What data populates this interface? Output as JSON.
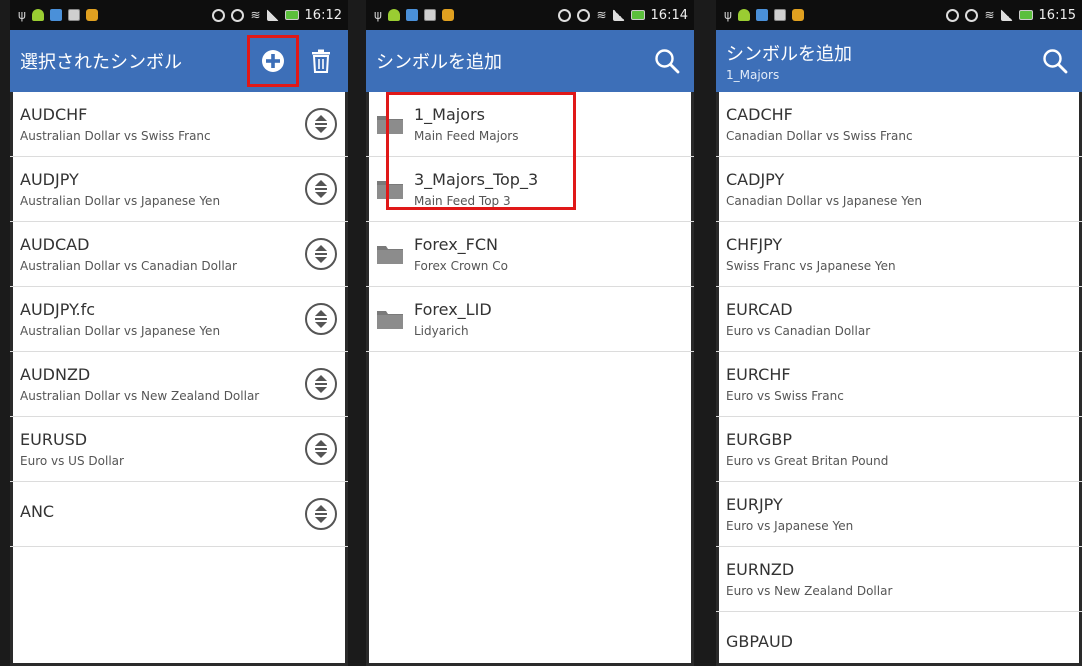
{
  "status_bars": [
    {
      "time": "16:12"
    },
    {
      "time": "16:14"
    },
    {
      "time": "16:15"
    }
  ],
  "screen1": {
    "title": "選択されたシンボル",
    "symbols": [
      {
        "name": "AUDCHF",
        "desc": "Australian Dollar vs Swiss Franc"
      },
      {
        "name": "AUDJPY",
        "desc": "Australian Dollar vs Japanese Yen"
      },
      {
        "name": "AUDCAD",
        "desc": "Australian Dollar vs Canadian Dollar"
      },
      {
        "name": "AUDJPY.fc",
        "desc": "Australian Dollar vs Japanese Yen"
      },
      {
        "name": "AUDNZD",
        "desc": "Australian Dollar vs New Zealand Dollar"
      },
      {
        "name": "EURUSD",
        "desc": "Euro vs US Dollar"
      },
      {
        "name": "ANC",
        "desc": ""
      }
    ]
  },
  "screen2": {
    "title": "シンボルを追加",
    "folders": [
      {
        "name": "1_Majors",
        "desc": "Main Feed Majors"
      },
      {
        "name": "3_Majors_Top_3",
        "desc": "Main Feed Top 3"
      },
      {
        "name": "Forex_FCN",
        "desc": "Forex Crown Co"
      },
      {
        "name": "Forex_LID",
        "desc": "Lidyarich"
      }
    ]
  },
  "screen3": {
    "title": "シンボルを追加",
    "subtitle": "1_Majors",
    "symbols": [
      {
        "name": "CADCHF",
        "desc": "Canadian Dollar vs Swiss Franc"
      },
      {
        "name": "CADJPY",
        "desc": "Canadian Dollar vs Japanese Yen"
      },
      {
        "name": "CHFJPY",
        "desc": "Swiss Franc vs Japanese Yen"
      },
      {
        "name": "EURCAD",
        "desc": "Euro vs Canadian Dollar"
      },
      {
        "name": "EURCHF",
        "desc": "Euro vs Swiss Franc"
      },
      {
        "name": "EURGBP",
        "desc": "Euro vs Great Britan Pound"
      },
      {
        "name": "EURJPY",
        "desc": "Euro vs Japanese Yen"
      },
      {
        "name": "EURNZD",
        "desc": "Euro vs New Zealand Dollar"
      },
      {
        "name": "GBPAUD",
        "desc": ""
      }
    ]
  },
  "colors": {
    "action_bar": "#3d6fb8",
    "highlight": "#e01818"
  }
}
